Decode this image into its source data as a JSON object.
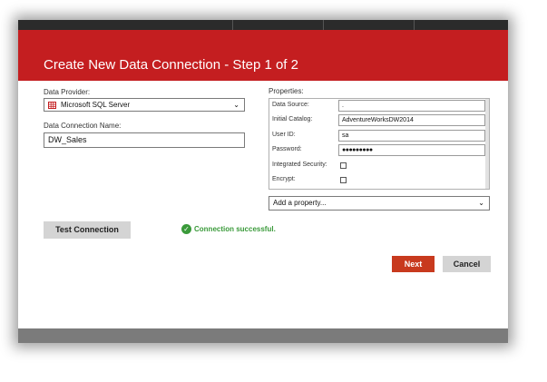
{
  "title": "Create New Data Connection - Step 1 of 2",
  "data_provider": {
    "label": "Data Provider:",
    "value": "Microsoft SQL Server",
    "icon": "sql-server-table-icon"
  },
  "connection_name": {
    "label": "Data Connection Name:",
    "value": "DW_Sales"
  },
  "properties": {
    "label": "Properties:",
    "rows": [
      {
        "label": "Data Source:",
        "value": ".",
        "type": "text"
      },
      {
        "label": "Initial Catalog:",
        "value": "AdventureWorksDW2014",
        "type": "text"
      },
      {
        "label": "User ID:",
        "value": "sa",
        "type": "text"
      },
      {
        "label": "Password:",
        "value": "●●●●●●●●●",
        "type": "password"
      },
      {
        "label": "Integrated Security:",
        "checked": false,
        "type": "checkbox"
      },
      {
        "label": "Encrypt:",
        "checked": false,
        "type": "checkbox"
      }
    ],
    "add_property": "Add a property..."
  },
  "test_button": "Test Connection",
  "status": {
    "message": "Connection successful.",
    "icon": "checkmark-circle-icon",
    "color": "#3a9a3a"
  },
  "buttons": {
    "next": "Next",
    "cancel": "Cancel"
  },
  "colors": {
    "title_bar": "#c41e20",
    "next_button": "#c83a1e",
    "secondary_button": "#d4d4d4",
    "footer_bar": "#7b7b7b"
  }
}
